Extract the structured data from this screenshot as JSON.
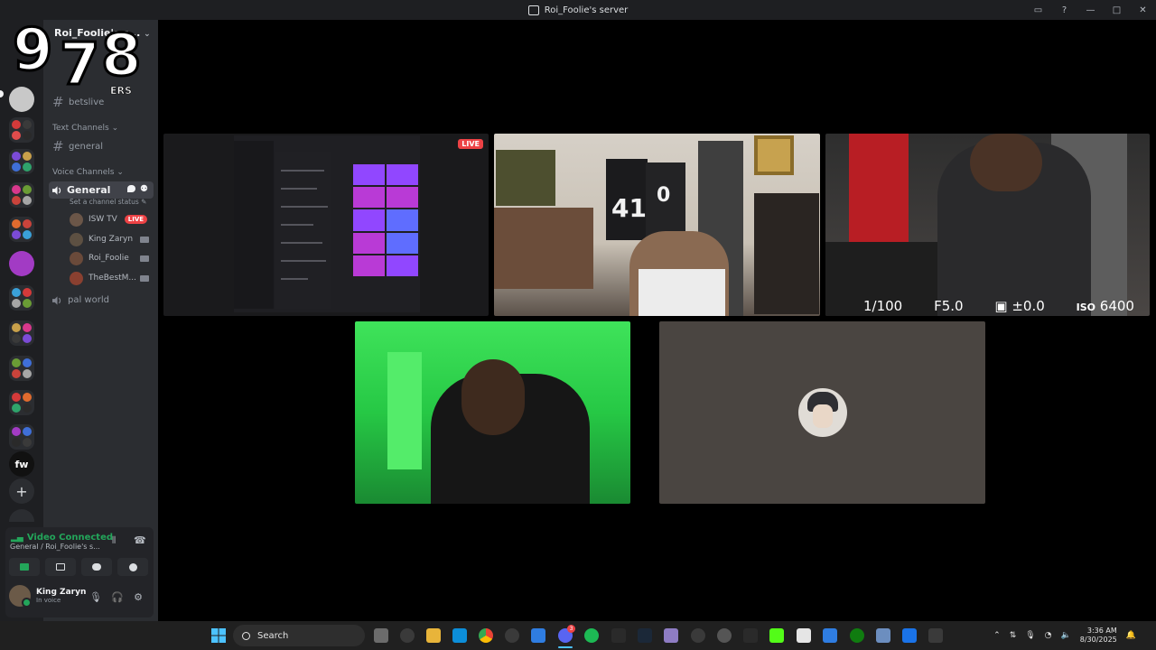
{
  "window": {
    "title": "Roi_Foolie's server"
  },
  "logo": {
    "digits": [
      "9",
      "7",
      "8"
    ],
    "suffix": "ERS"
  },
  "sidebar": {
    "server_name": "Roi_Foolie's s...",
    "channels_top": [
      {
        "name": "betslive"
      }
    ],
    "text_category": "Text Channels",
    "text_channels": [
      {
        "name": "general"
      }
    ],
    "voice_category": "Voice Channels",
    "voice_channel": {
      "name": "General",
      "status_placeholder": "Set a channel status"
    },
    "voice_users": [
      {
        "name": "ISW TV",
        "badge": "LIVE",
        "color": "#6b5648"
      },
      {
        "name": "King Zaryn",
        "color": "#5d5042"
      },
      {
        "name": "Roi_Foolie",
        "color": "#6a4a3a"
      },
      {
        "name": "TheBestM...",
        "color": "#8a4030"
      }
    ],
    "other_voice": {
      "name": "pal world"
    }
  },
  "connection": {
    "status": "Video Connected",
    "location": "General / Roi_Foolie's s..."
  },
  "user": {
    "name": "King Zaryn",
    "status": "In voice"
  },
  "stage": {
    "screen_live_tag": "LIVE",
    "jersey_numbers": [
      "41",
      "0"
    ],
    "camera_hud": {
      "shutter": "1/100",
      "aperture": "F5.0",
      "exposure": "±0.0",
      "iso_label": "ISO",
      "iso_value": "6400"
    }
  },
  "server_rail": {
    "fw_label": "fw",
    "colors": [
      "#d43a3a",
      "#3f6fd8",
      "#c8a04a",
      "#7b4bd6",
      "#2fa36b",
      "#e06b2e",
      "#a23bc4",
      "#3aa0d8",
      "#c9433b",
      "#6a9c35",
      "#d8388c",
      "#a6a6a6"
    ]
  },
  "taskbar": {
    "search_placeholder": "Search",
    "time": "3:36 AM",
    "date": "8/30/2025",
    "discord_badge": "3"
  }
}
